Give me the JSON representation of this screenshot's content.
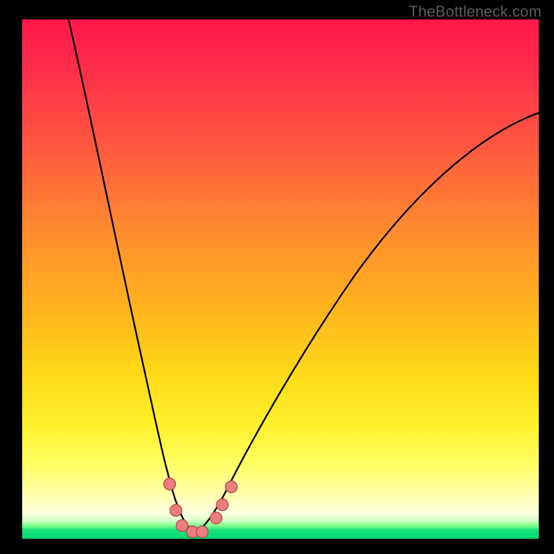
{
  "watermark": "TheBottleneck.com",
  "colors": {
    "background_frame": "#000000",
    "gradient_top": "#ff174a",
    "gradient_mid1": "#ff8a2f",
    "gradient_mid2": "#ffd918",
    "gradient_pale": "#ffffb5",
    "gradient_green": "#00d873",
    "curve_stroke": "#000000",
    "marker_fill": "#eb7e7d",
    "marker_stroke": "#b84f4f"
  },
  "chart_data": {
    "type": "line",
    "title": "",
    "xlabel": "",
    "ylabel": "",
    "xlim": [
      0,
      100
    ],
    "ylim": [
      0,
      100
    ],
    "note": "No numeric axis ticks or labels are visible; values are estimated from pixel positions within the plot area normalised to 0–100.",
    "series": [
      {
        "name": "curve",
        "x": [
          9,
          14,
          18,
          22,
          25,
          27,
          29,
          30,
          32,
          33.5,
          35,
          37,
          40,
          45,
          52,
          60,
          70,
          80,
          90,
          100
        ],
        "y": [
          100,
          77,
          59,
          42,
          29,
          20,
          12,
          7,
          3,
          1.3,
          3,
          7,
          13,
          23,
          36,
          48,
          60,
          69,
          76,
          82
        ]
      }
    ],
    "markers": [
      {
        "x": 28.5,
        "y": 10.5
      },
      {
        "x": 29.8,
        "y": 5.5
      },
      {
        "x": 31.0,
        "y": 2.5
      },
      {
        "x": 33.0,
        "y": 1.3
      },
      {
        "x": 34.8,
        "y": 1.3
      },
      {
        "x": 37.5,
        "y": 4.0
      },
      {
        "x": 38.8,
        "y": 6.5
      },
      {
        "x": 40.5,
        "y": 10.0
      }
    ]
  }
}
